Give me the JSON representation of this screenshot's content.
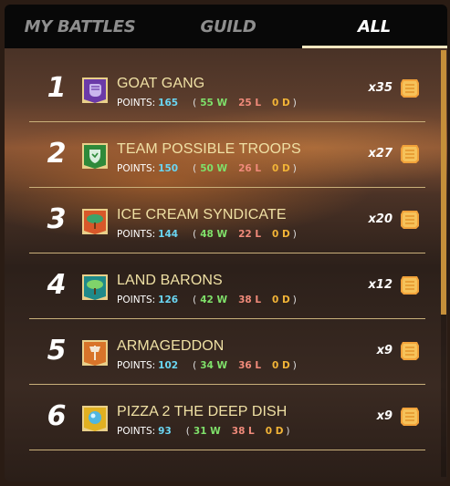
{
  "tabs": [
    {
      "label": "MY BATTLES",
      "active": false
    },
    {
      "label": "GUILD",
      "active": false
    },
    {
      "label": "ALL",
      "active": true
    }
  ],
  "rows": [
    {
      "rank": "1",
      "name": "GOAT GANG",
      "points_label": "POINTS:",
      "points": "165",
      "open": "(",
      "wins": "55 W",
      "losses": "25 L",
      "draws": "0 D",
      "close": ")",
      "reward": "x35",
      "emblem": "purple-fist-icon"
    },
    {
      "rank": "2",
      "name": "TEAM POSSIBLE TROOPS",
      "points_label": "POINTS:",
      "points": "150",
      "open": "(",
      "wins": "50 W",
      "losses": "26 L",
      "draws": "0 D",
      "close": ")",
      "reward": "x27",
      "emblem": "green-shield-icon"
    },
    {
      "rank": "3",
      "name": "ICE CREAM SYNDICATE",
      "points_label": "POINTS:",
      "points": "144",
      "open": "(",
      "wins": "48 W",
      "losses": "22 L",
      "draws": "0 D",
      "close": ")",
      "reward": "x20",
      "emblem": "orange-tree-icon"
    },
    {
      "rank": "4",
      "name": "LAND BARONS",
      "points_label": "POINTS:",
      "points": "126",
      "open": "(",
      "wins": "42 W",
      "losses": "38 L",
      "draws": "0 D",
      "close": ")",
      "reward": "x12",
      "emblem": "teal-tree-icon"
    },
    {
      "rank": "5",
      "name": "ARMAGEDDON",
      "points_label": "POINTS:",
      "points": "102",
      "open": "(",
      "wins": "34 W",
      "losses": "36 L",
      "draws": "0 D",
      "close": ")",
      "reward": "x9",
      "emblem": "orange-axe-icon"
    },
    {
      "rank": "6",
      "name": "PIZZA 2 THE DEEP DISH",
      "points_label": "POINTS:",
      "points": "93",
      "open": "(",
      "wins": "31 W",
      "losses": "38 L",
      "draws": "0 D",
      "close": ")",
      "reward": "x9",
      "emblem": "gold-orb-icon"
    }
  ],
  "colors": {
    "name": "#efe0a4",
    "points": "#6ad6f3",
    "wins": "#7fe06a",
    "losses": "#f08a7a",
    "draws": "#f2b437",
    "divider": "#c9b07a"
  },
  "reward_icon": "gold-chest-icon"
}
